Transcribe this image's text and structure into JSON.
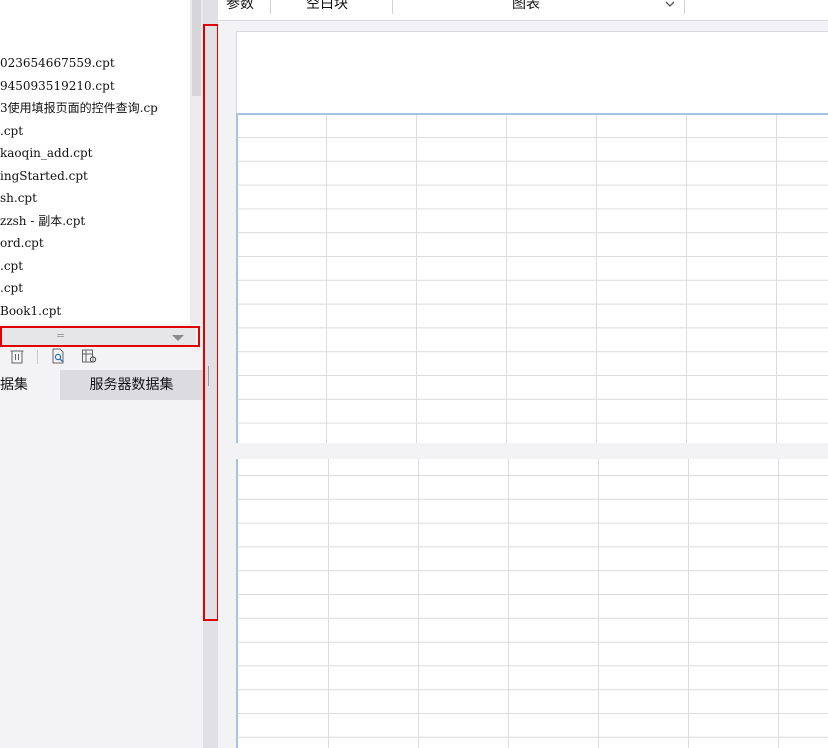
{
  "toolbar": {
    "items": [
      {
        "label": "参数"
      },
      {
        "label": "空白块"
      },
      {
        "label": "图表"
      }
    ],
    "dropdown_icon": "chevron-down-icon"
  },
  "file_tree": {
    "files": [
      "023654667559.cpt",
      "945093519210.cpt",
      "3使用填报页面的控件查询.cp",
      ".cpt",
      "kaoqin_add.cpt",
      "ingStarted.cpt",
      "sh.cpt",
      "zzsh - 副本.cpt",
      "ord.cpt",
      ".cpt",
      ".cpt",
      "Book1.cpt"
    ]
  },
  "splitter": {
    "grip": "="
  },
  "left_toolbar": {
    "icons": [
      "delete-icon",
      "search-preview-icon",
      "edit-dataset-icon"
    ]
  },
  "dataset_tabs": [
    {
      "label": "据集"
    },
    {
      "label": "服务器数据集"
    }
  ],
  "colors": {
    "highlight": "#e00000",
    "grid_line": "#dcdce0",
    "grid_border": "#a6c3e0",
    "panel_bg": "#f3f3f6"
  }
}
